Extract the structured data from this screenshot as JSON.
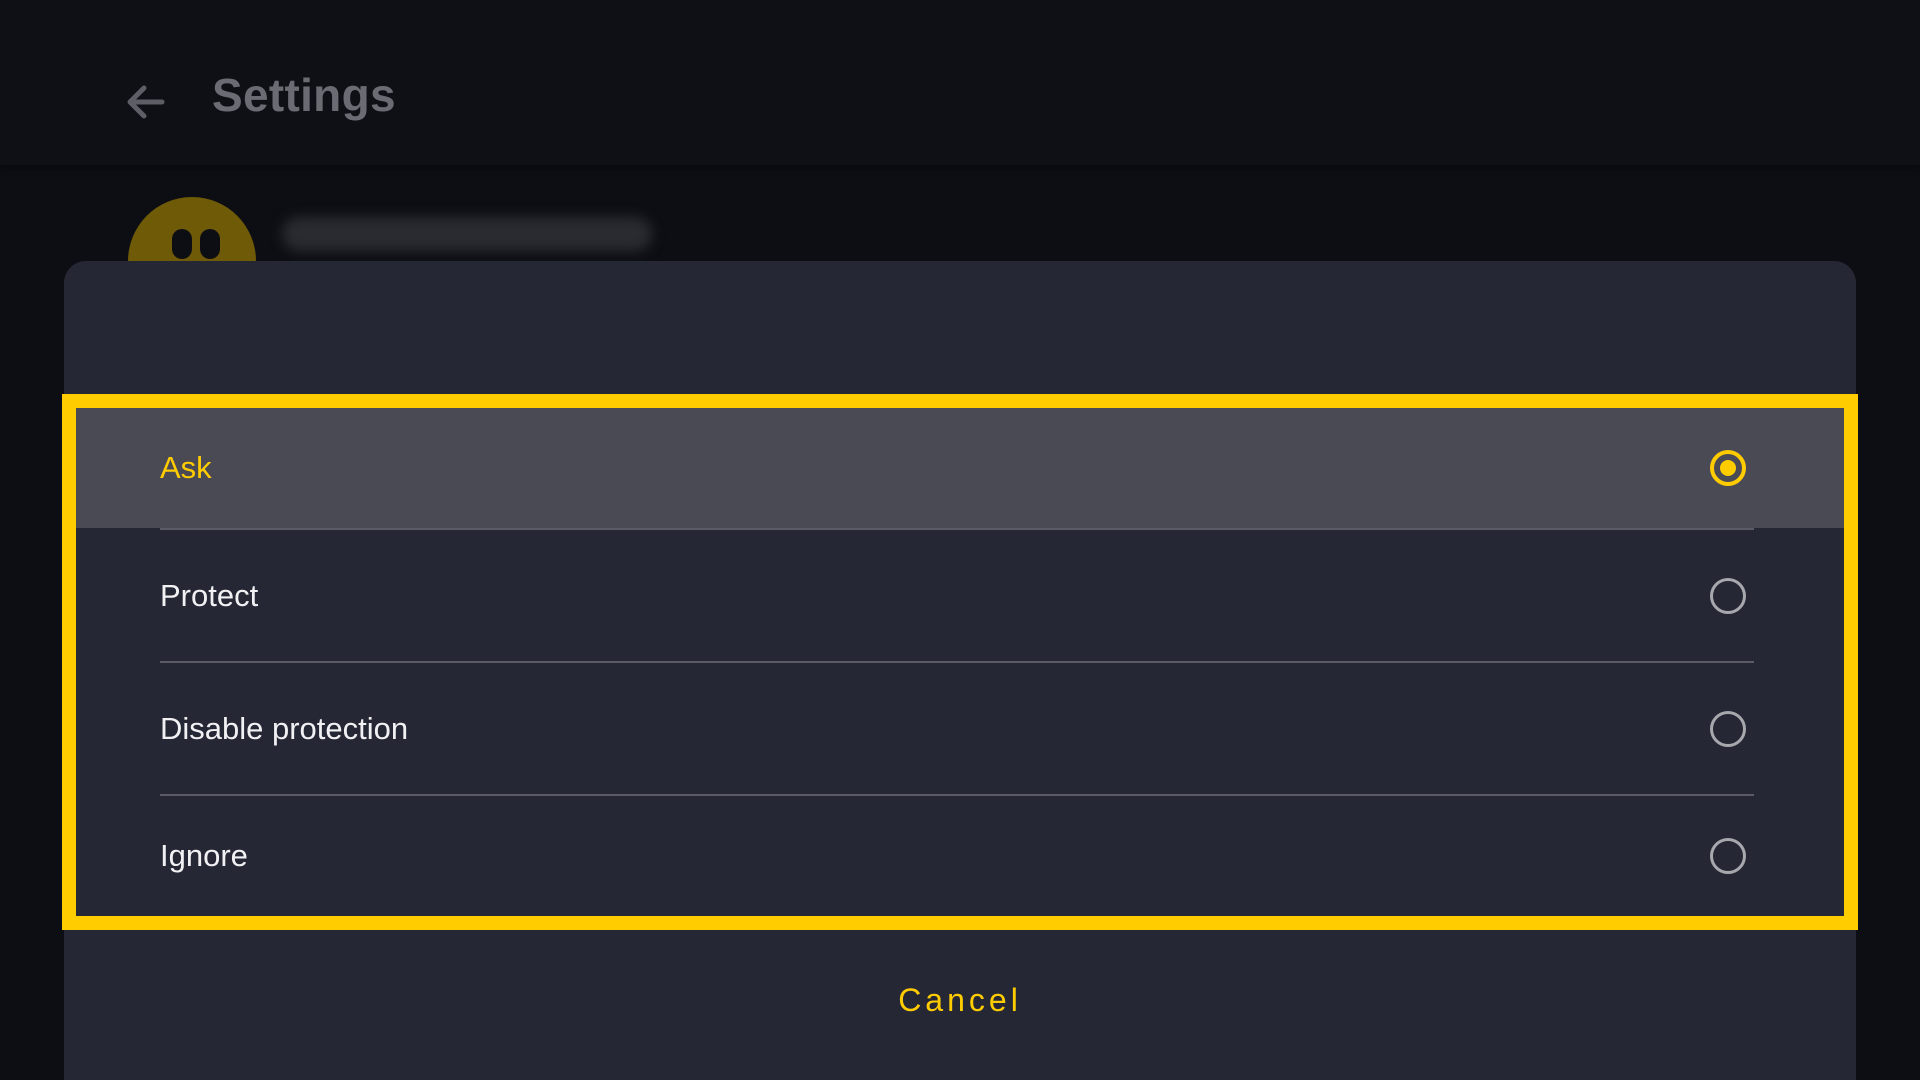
{
  "header": {
    "title": "Settings",
    "back_icon": "arrow-left-icon"
  },
  "account": {
    "avatar_icon": "ghost-avatar-icon",
    "name": ""
  },
  "dialog": {
    "options": [
      {
        "label": "Ask",
        "selected": true
      },
      {
        "label": "Protect",
        "selected": false
      },
      {
        "label": "Disable protection",
        "selected": false
      },
      {
        "label": "Ignore",
        "selected": false
      }
    ],
    "cancel_label": "Cancel"
  },
  "colors": {
    "accent": "#ffcc00",
    "dialog_bg": "#252735",
    "selected_row_bg": "#4a4a55",
    "app_bg": "#0d0e14"
  }
}
